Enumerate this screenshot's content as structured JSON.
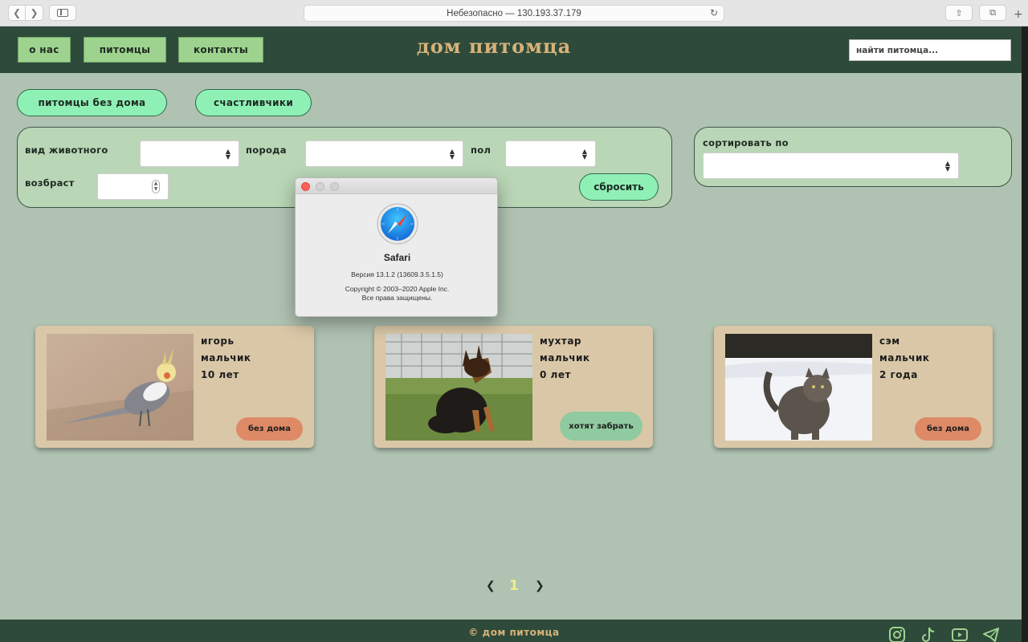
{
  "browser": {
    "address": "Небезопасно — 130.193.37.179"
  },
  "header": {
    "nav": [
      "о нас",
      "питомцы",
      "контакты"
    ],
    "logo": "дом питомца",
    "search_placeholder": "найти питомца..."
  },
  "tabs": [
    "питомцы без дома",
    "счастливчики"
  ],
  "filters": {
    "species_label": "вид животного",
    "breed_label": "порода",
    "sex_label": "пол",
    "age_label": "возбраст",
    "reset_label": "сбросить",
    "sort_label": "сортировать по"
  },
  "pets": [
    {
      "name": "игорь",
      "sex": "мальчик",
      "age": "10 лет",
      "status": "без дома",
      "photo": "cockatiel"
    },
    {
      "name": "мухтар",
      "sex": "мальчик",
      "age": "0 лет",
      "status": "хотят забрать",
      "photo": "german-shepherd-puppy"
    },
    {
      "name": "сэм",
      "sex": "мальчик",
      "age": "2 года",
      "status": "без дома",
      "photo": "cat-in-snow"
    }
  ],
  "pagination": {
    "prev": "❮",
    "current": "1",
    "next": "❯"
  },
  "footer": {
    "text": "© дом питомца",
    "social": [
      "instagram-icon",
      "tiktok-icon",
      "youtube-icon",
      "telegram-icon"
    ]
  },
  "about_dialog": {
    "app": "Safari",
    "version": "Версия 13.1.2 (13609.3.5.1.5)",
    "copyright": "Copyright © 2003–2020 Apple Inc.",
    "rights": "Все права защищены."
  },
  "colors": {
    "page_bg": "#b0c2b1",
    "header_bg": "#2e4a3a",
    "accent_green": "#8ff0b6",
    "logo_gold": "#d6b27a",
    "homeless_badge": "#df8a67",
    "wanted_badge": "#8fcaa0",
    "card_bg": "#d9c7a7"
  }
}
